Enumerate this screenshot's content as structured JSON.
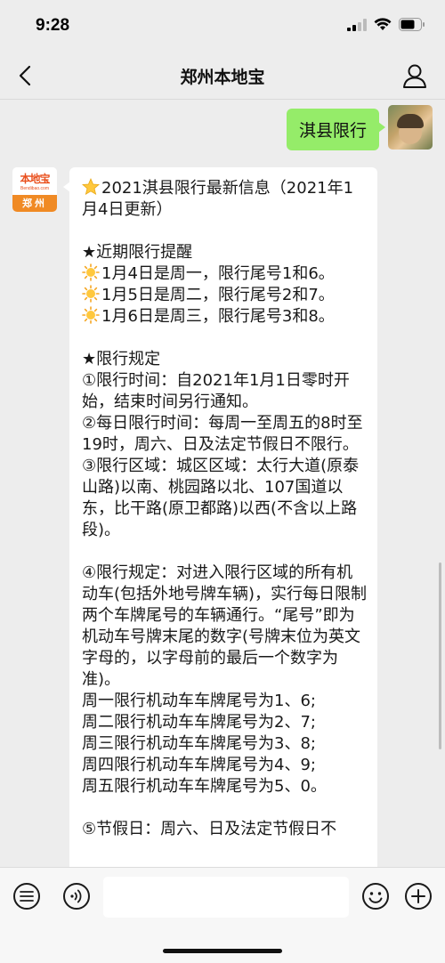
{
  "status_bar": {
    "time": "9:28"
  },
  "nav": {
    "title": "郑州本地宝"
  },
  "messages": {
    "user_text": "淇县限行",
    "bot_avatar": {
      "title": "本地宝",
      "subtitle": "Bendibao.com",
      "city": "郑州"
    },
    "bot_lines": [
      "2021淇县限行最新信息（2021年1月4日更新）",
      "",
      "★近期限行提醒",
      "1月4日是周一，限行尾号1和6。",
      "1月5日是周二，限行尾号2和7。",
      "1月6日是周三，限行尾号3和8。",
      "",
      "★限行规定",
      "①限行时间：自2021年1月1日零时开始，结束时间另行通知。",
      "②每日限行时间：每周一至周五的8时至19时，周六、日及法定节假日不限行。",
      "③限行区域：城区区域：太行大道(原泰山路)以南、桃园路以北、107国道以东，比干路(原卫都路)以西(不含以上路段)。",
      "",
      "④限行规定：对进入限行区域的所有机动车(包括外地号牌车辆)，实行每日限制两个车牌尾号的车辆通行。“尾号”即为机动车号牌末尾的数字(号牌末位为英文字母的，以字母前的最后一个数字为准)。",
      "周一限行机动车车牌尾号为1、6;",
      "周二限行机动车车牌尾号为2、7;",
      "周三限行机动车车牌尾号为3、8;",
      "周四限行机动车车牌尾号为4、9;",
      "周五限行机动车车牌尾号为5、0。",
      "",
      "⑤节假日：周六、日及法定节假日不"
    ]
  },
  "icons": {
    "star": "star-icon",
    "sun": "sun-icon"
  },
  "colors": {
    "bubble_green": "#95ec69",
    "bubble_white": "#ffffff",
    "background": "#ededed",
    "logo_orange": "#f08a24"
  }
}
